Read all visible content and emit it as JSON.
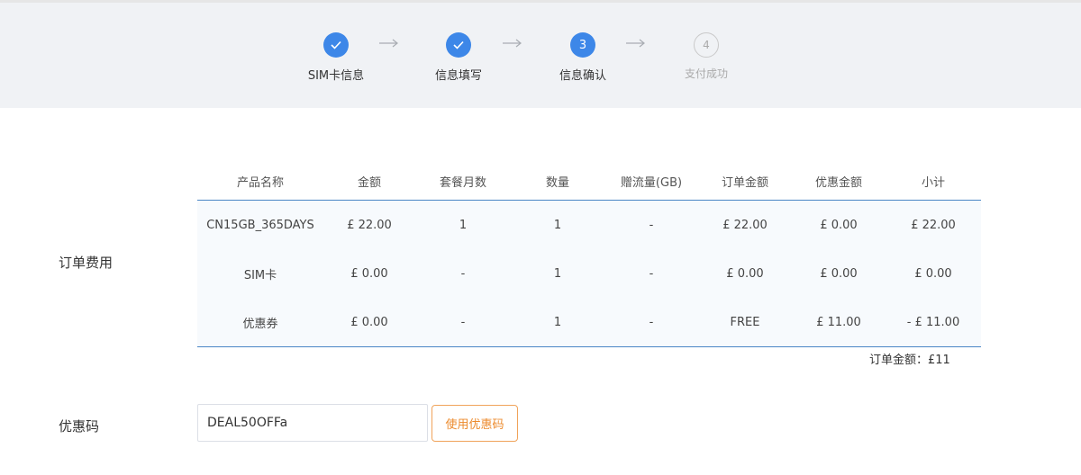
{
  "steps": [
    {
      "index": "1",
      "label": "SIM卡信息",
      "state": "done",
      "icon": "check-icon"
    },
    {
      "index": "2",
      "label": "信息填写",
      "state": "done",
      "icon": "check-icon"
    },
    {
      "index": "3",
      "label": "信息确认",
      "state": "active"
    },
    {
      "index": "4",
      "label": "支付成功",
      "state": "todo"
    }
  ],
  "colors": {
    "accent": "#3d87e8",
    "step_bg": "#f0f2f5",
    "coupon_button": "#ec8a2c",
    "table_line": "#4a86c5"
  },
  "order_fee": {
    "label": "订单费用",
    "headers": [
      "产品名称",
      "金额",
      "套餐月数",
      "数量",
      "赠流量(GB)",
      "订单金额",
      "优惠金额",
      "小计"
    ],
    "rows": [
      [
        "CN15GB_365DAYS",
        "£ 22.00",
        "1",
        "1",
        "-",
        "£ 22.00",
        "£ 0.00",
        "£ 22.00"
      ],
      [
        "SIM卡",
        "£ 0.00",
        "-",
        "1",
        "-",
        "£ 0.00",
        "£ 0.00",
        "£ 0.00"
      ],
      [
        "优惠券",
        "£ 0.00",
        "-",
        "1",
        "-",
        "FREE",
        "£ 11.00",
        "- £ 11.00"
      ]
    ],
    "total_text": "订单金额：£11"
  },
  "coupon": {
    "label": "优惠码",
    "value": "DEAL50OFFa",
    "button_label": "使用优惠码"
  }
}
